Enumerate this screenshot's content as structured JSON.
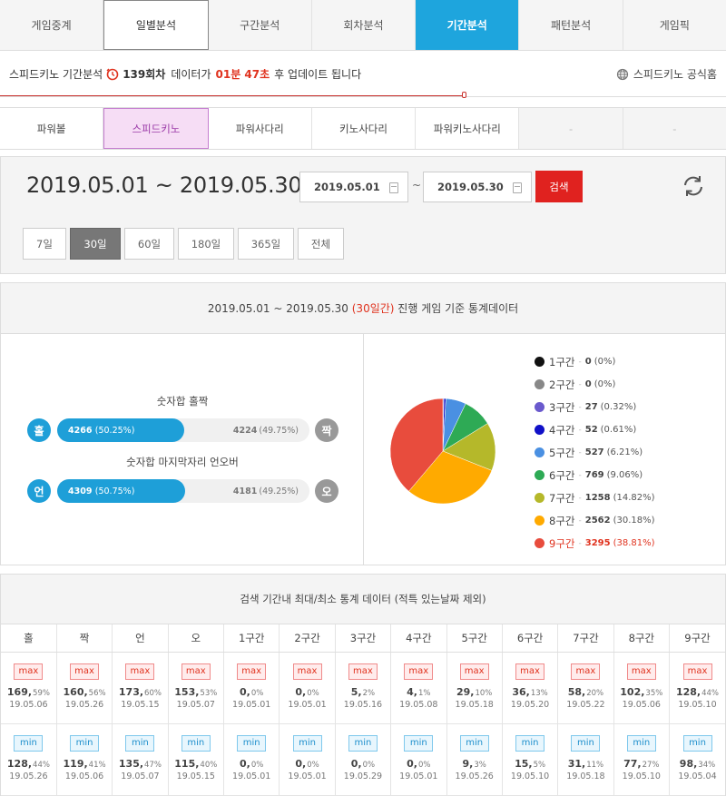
{
  "top_tabs": [
    "게임중계",
    "일별분석",
    "구간분석",
    "회차분석",
    "기간분석",
    "패턴분석",
    "게임픽"
  ],
  "info": {
    "prefix": "스피드키노 기간분석",
    "round": "139회차",
    "mid": "데이터가",
    "countdown": "01분 47초",
    "suffix": "후 업데이트 됩니다",
    "official": "스피드키노 공식홈",
    "progress": 0.64
  },
  "game_tabs": [
    "파워볼",
    "스피드키노",
    "파워사다리",
    "키노사다리",
    "파워키노사다리",
    "-",
    "-"
  ],
  "date_panel": {
    "range": "2019.05.01 ~ 2019.05.30",
    "start": "2019.05.01",
    "end": "2019.05.30",
    "tilde": "~",
    "search": "검색",
    "periods": [
      "7일",
      "30일",
      "60일",
      "180일",
      "365일",
      "전체"
    ]
  },
  "stats": {
    "header_prefix": "2019.05.01 ~ 2019.05.30",
    "header_days": "(30일간)",
    "header_suffix": "진행 게임 기준 통계데이터",
    "odd_even": {
      "title": "숫자합 홀짝",
      "left_label": "홀",
      "right_label": "짝",
      "left_count": "4266",
      "left_pct": "(50.25%)",
      "right_count": "4224",
      "right_pct": "(49.75%)",
      "ratio": 0.5025
    },
    "under_over": {
      "title": "숫자합 마지막자리 언오버",
      "left_label": "언",
      "right_label": "오",
      "left_count": "4309",
      "left_pct": "(50.75%)",
      "right_count": "4181",
      "right_pct": "(49.25%)",
      "ratio": 0.5075
    }
  },
  "chart_data": {
    "type": "pie",
    "categories": [
      "1구간",
      "2구간",
      "3구간",
      "4구간",
      "5구간",
      "6구간",
      "7구간",
      "8구간",
      "9구간"
    ],
    "values": [
      0,
      0,
      27,
      52,
      527,
      769,
      1258,
      2562,
      3295
    ],
    "percent_labels": [
      "(0%)",
      "(0%)",
      "(0.32%)",
      "(0.61%)",
      "(6.21%)",
      "(9.06%)",
      "(14.82%)",
      "(30.18%)",
      "(38.81%)"
    ],
    "colors": [
      "#111111",
      "#888888",
      "#6a5acd",
      "#1010c8",
      "#4a90e2",
      "#2eaa55",
      "#b5b82a",
      "#ffaa00",
      "#e84c3d"
    ],
    "highlight_index": 8,
    "sep": "-"
  },
  "maxmin": {
    "title": "검색 기간내 최대/최소 통계 데이터 (적특 있는날짜 제외)",
    "columns": [
      "홀",
      "짝",
      "언",
      "오",
      "1구간",
      "2구간",
      "3구간",
      "4구간",
      "5구간",
      "6구간",
      "7구간",
      "8구간",
      "9구간"
    ],
    "max_label": "max",
    "min_label": "min",
    "max": [
      {
        "v": "169",
        "p": "59%",
        "d": "19.05.06"
      },
      {
        "v": "160",
        "p": "56%",
        "d": "19.05.26"
      },
      {
        "v": "173",
        "p": "60%",
        "d": "19.05.15"
      },
      {
        "v": "153",
        "p": "53%",
        "d": "19.05.07"
      },
      {
        "v": "0",
        "p": "0%",
        "d": "19.05.01"
      },
      {
        "v": "0",
        "p": "0%",
        "d": "19.05.01"
      },
      {
        "v": "5",
        "p": "2%",
        "d": "19.05.16"
      },
      {
        "v": "4",
        "p": "1%",
        "d": "19.05.08"
      },
      {
        "v": "29",
        "p": "10%",
        "d": "19.05.18"
      },
      {
        "v": "36",
        "p": "13%",
        "d": "19.05.20"
      },
      {
        "v": "58",
        "p": "20%",
        "d": "19.05.22"
      },
      {
        "v": "102",
        "p": "35%",
        "d": "19.05.06"
      },
      {
        "v": "128",
        "p": "44%",
        "d": "19.05.10"
      }
    ],
    "min": [
      {
        "v": "128",
        "p": "44%",
        "d": "19.05.26"
      },
      {
        "v": "119",
        "p": "41%",
        "d": "19.05.06"
      },
      {
        "v": "135",
        "p": "47%",
        "d": "19.05.07"
      },
      {
        "v": "115",
        "p": "40%",
        "d": "19.05.15"
      },
      {
        "v": "0",
        "p": "0%",
        "d": "19.05.01"
      },
      {
        "v": "0",
        "p": "0%",
        "d": "19.05.01"
      },
      {
        "v": "0",
        "p": "0%",
        "d": "19.05.29"
      },
      {
        "v": "0",
        "p": "0%",
        "d": "19.05.01"
      },
      {
        "v": "9",
        "p": "3%",
        "d": "19.05.26"
      },
      {
        "v": "15",
        "p": "5%",
        "d": "19.05.10"
      },
      {
        "v": "31",
        "p": "11%",
        "d": "19.05.18"
      },
      {
        "v": "77",
        "p": "27%",
        "d": "19.05.10"
      },
      {
        "v": "98",
        "p": "34%",
        "d": "19.05.04"
      }
    ]
  }
}
